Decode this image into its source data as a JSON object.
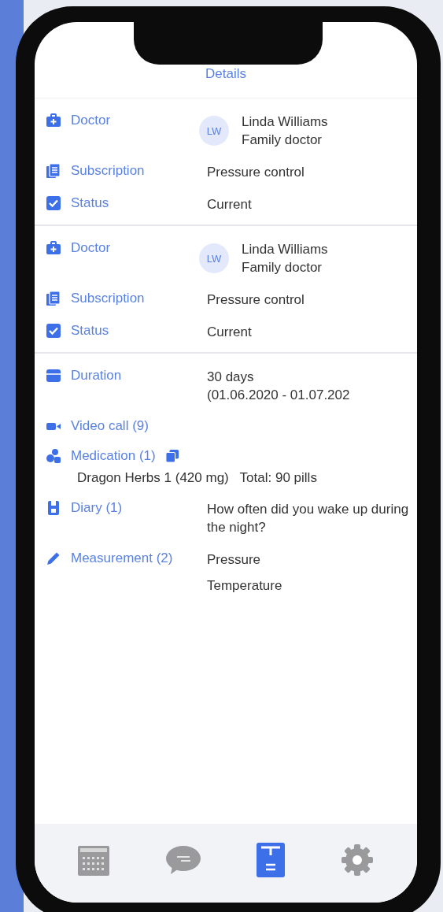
{
  "header": {
    "title": "Details"
  },
  "sections": [
    {
      "rows": [
        {
          "kind": "doctor",
          "label": "Doctor",
          "avatar": "LW",
          "lines": [
            "Linda Williams",
            "Family doctor"
          ]
        },
        {
          "kind": "subscription",
          "label": "Subscription",
          "lines": [
            "Pressure control"
          ]
        },
        {
          "kind": "status",
          "label": "Status",
          "lines": [
            "Current"
          ]
        }
      ]
    },
    {
      "rows": [
        {
          "kind": "doctor",
          "label": "Doctor",
          "avatar": "LW",
          "lines": [
            "Linda Williams",
            "Family doctor"
          ]
        },
        {
          "kind": "subscription",
          "label": "Subscription",
          "lines": [
            "Pressure control"
          ]
        },
        {
          "kind": "status",
          "label": "Status",
          "lines": [
            "Current"
          ]
        }
      ]
    },
    {
      "rows": [
        {
          "kind": "duration",
          "label": "Duration",
          "lines": [
            "30 days",
            "(01.06.2020 -  01.07.202"
          ]
        },
        {
          "kind": "video",
          "label": "Video call (9)",
          "lines": []
        },
        {
          "kind": "medication",
          "label": "Medication (1)",
          "detail": "Dragon Herbs 1 (420 mg)   Total: 90 pills"
        },
        {
          "kind": "diary",
          "label": "Diary (1)",
          "lines": [
            "How often did you wake up during the night?"
          ]
        },
        {
          "kind": "measurement",
          "label": "Measurement (2)",
          "lines": [
            "Pressure",
            "Temperature"
          ]
        }
      ]
    }
  ],
  "tabs": [
    {
      "kind": "calendar",
      "selected": false
    },
    {
      "kind": "chat",
      "selected": false
    },
    {
      "kind": "document",
      "selected": true
    },
    {
      "kind": "settings",
      "selected": false
    }
  ]
}
